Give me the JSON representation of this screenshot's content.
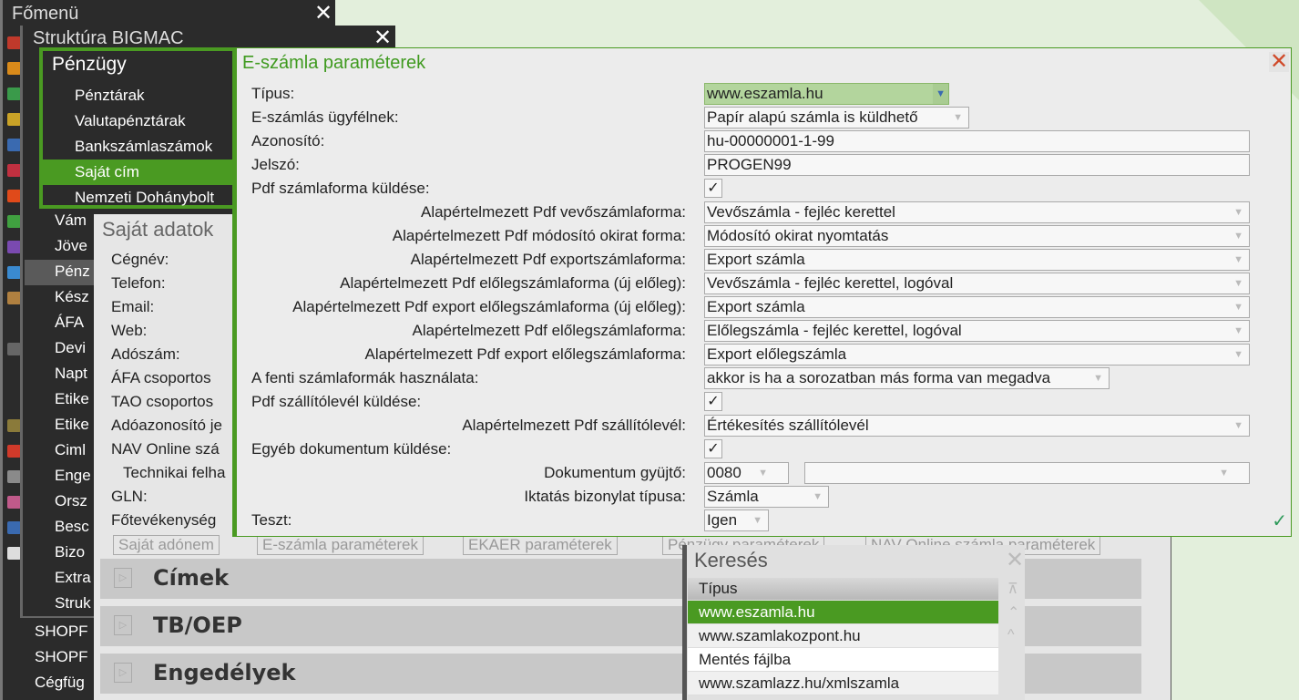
{
  "fomenu": {
    "title": "Főmenü",
    "items": [
      "SHOPF",
      "SHOPF",
      "Cégfüg"
    ]
  },
  "struktura": {
    "title": "Struktúra BIGMAC",
    "items": [
      "Vám",
      "Jöve",
      "Pénz",
      "Kész",
      "ÁFA",
      "Devi",
      "Napt",
      "Etike",
      "Etike",
      "Ciml",
      "Enge",
      "Orsz",
      "Besc",
      "Bizo",
      "Extra",
      "Struk"
    ]
  },
  "penzugy": {
    "title": "Pénzügy",
    "items": [
      "Pénztárak",
      "Valutapénztárak",
      "Bankszámlaszámok",
      "Saját cím",
      "Nemzeti Dohánybolt"
    ],
    "selected": 3
  },
  "sajat": {
    "title": "Saját adatok",
    "labels": [
      "Cégnév:",
      "Telefon:",
      "Email:",
      "Web:",
      "Adószám:",
      "ÁFA csoportos",
      "TAO csoportos",
      "Adóazonosító je",
      "NAV Online szá",
      "Technikai felha",
      "GLN:",
      "Főtevékenység"
    ],
    "buttons": [
      "Saját adónem",
      "E-számla paraméterek",
      "EKAER paraméterek",
      "Pénzügy paraméterek",
      "NAV Online számla paraméterek"
    ],
    "sections": [
      "Címek",
      "TB/OEP",
      "Engedélyek"
    ]
  },
  "dialog": {
    "title": "E-számla paraméterek",
    "rows": [
      {
        "label": "Típus:",
        "value": "www.eszamla.hu",
        "kind": "select"
      },
      {
        "label": "E-számlás ügyfélnek:",
        "value": "Papír alapú számla is küldhető",
        "kind": "select"
      },
      {
        "label": "Azonosító:",
        "value": "hu-00000001-1-99",
        "kind": "text"
      },
      {
        "label": "Jelszó:",
        "value": "PROGEN99",
        "kind": "text"
      },
      {
        "label": "Pdf számlaforma küldése:",
        "value": "✓",
        "kind": "check"
      },
      {
        "label": "Alapértelmezett Pdf vevőszámlaforma:",
        "value": "Vevőszámla - fejléc kerettel",
        "kind": "select"
      },
      {
        "label": "Alapértelmezett Pdf módosító okirat forma:",
        "value": "Módosító okirat nyomtatás",
        "kind": "select"
      },
      {
        "label": "Alapértelmezett Pdf exportszámlaforma:",
        "value": "Export számla",
        "kind": "select"
      },
      {
        "label": "Alapértelmezett Pdf előlegszámlaforma (új előleg):",
        "value": "Vevőszámla - fejléc kerettel, logóval",
        "kind": "select"
      },
      {
        "label": "Alapértelmezett Pdf export előlegszámlaforma (új előleg):",
        "value": "Export számla",
        "kind": "select"
      },
      {
        "label": "Alapértelmezett Pdf előlegszámlaforma:",
        "value": "Előlegszámla - fejléc kerettel, logóval",
        "kind": "select"
      },
      {
        "label": "Alapértelmezett Pdf export előlegszámlaforma:",
        "value": "Export előlegszámla",
        "kind": "select"
      },
      {
        "label": "A fenti számlaformák használata:",
        "value": "akkor is ha a sorozatban más forma van megadva",
        "kind": "select"
      },
      {
        "label": "Pdf szállítólevél küldése:",
        "value": "✓",
        "kind": "check"
      },
      {
        "label": "Alapértelmezett Pdf szállítólevél:",
        "value": "Értékesítés szállítólevél",
        "kind": "select"
      },
      {
        "label": "Egyéb dokumentum küldése:",
        "value": "✓",
        "kind": "check"
      },
      {
        "label": "Dokumentum gyüjtő:",
        "value": "0080",
        "value2": "",
        "kind": "double"
      },
      {
        "label": "Iktatás bizonylat típusa:",
        "value": "Számla",
        "kind": "select"
      },
      {
        "label": "Teszt:",
        "value": "Igen",
        "kind": "select"
      }
    ],
    "accent": "#4a9a22"
  },
  "kereses": {
    "title": "Keresés",
    "header": "Típus",
    "rows": [
      "www.eszamla.hu",
      "www.szamlakozpont.hu",
      "Mentés fájlba",
      "www.szamlazz.hu/xmlszamla"
    ],
    "selected": 0
  }
}
